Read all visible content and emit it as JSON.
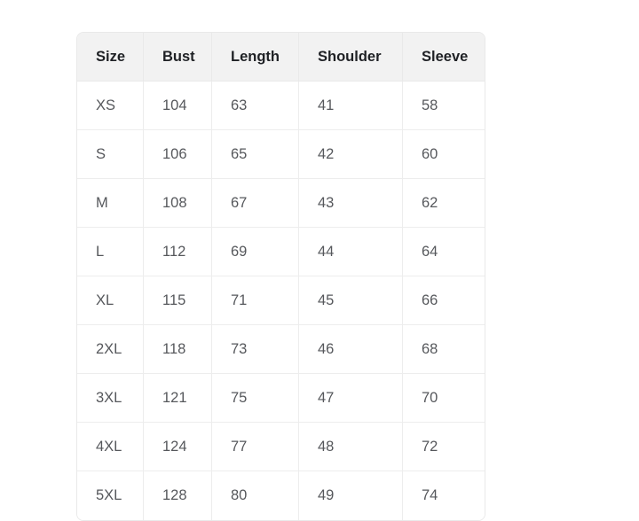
{
  "page": {
    "background_color": "#ffffff"
  },
  "size_chart": {
    "border_color": "#e9e9e9",
    "header_background": "#f2f2f2",
    "header_text_color": "#1f2125",
    "body_text_color": "#56585c",
    "columns": [
      {
        "key": "size",
        "label": "Size"
      },
      {
        "key": "bust",
        "label": "Bust"
      },
      {
        "key": "length",
        "label": "Length"
      },
      {
        "key": "shoulder",
        "label": "Shoulder"
      },
      {
        "key": "sleeve",
        "label": "Sleeve"
      }
    ],
    "rows": [
      {
        "size": "XS",
        "bust": "104",
        "length": "63",
        "shoulder": "41",
        "sleeve": "58"
      },
      {
        "size": "S",
        "bust": "106",
        "length": "65",
        "shoulder": "42",
        "sleeve": "60"
      },
      {
        "size": "M",
        "bust": "108",
        "length": "67",
        "shoulder": "43",
        "sleeve": "62"
      },
      {
        "size": "L",
        "bust": "112",
        "length": "69",
        "shoulder": "44",
        "sleeve": "64"
      },
      {
        "size": "XL",
        "bust": "115",
        "length": "71",
        "shoulder": "45",
        "sleeve": "66"
      },
      {
        "size": "2XL",
        "bust": "118",
        "length": "73",
        "shoulder": "46",
        "sleeve": "68"
      },
      {
        "size": "3XL",
        "bust": "121",
        "length": "75",
        "shoulder": "47",
        "sleeve": "70"
      },
      {
        "size": "4XL",
        "bust": "124",
        "length": "77",
        "shoulder": "48",
        "sleeve": "72"
      },
      {
        "size": "5XL",
        "bust": "128",
        "length": "80",
        "shoulder": "49",
        "sleeve": "74"
      }
    ]
  }
}
